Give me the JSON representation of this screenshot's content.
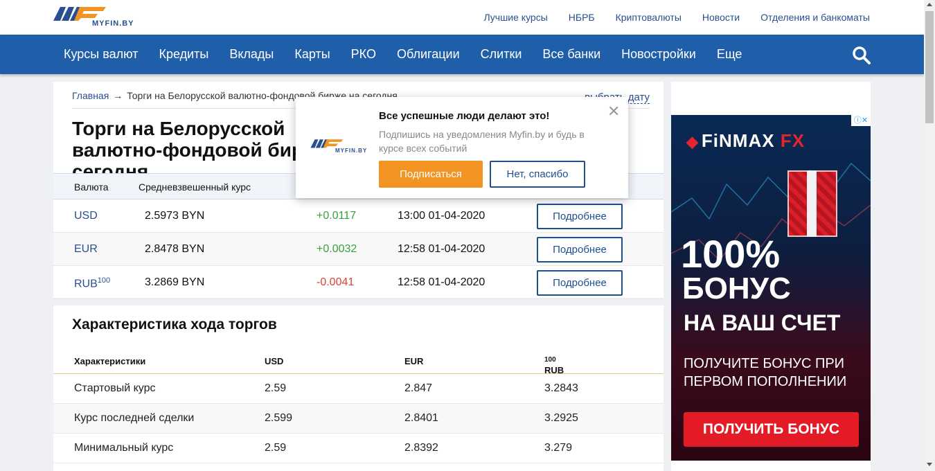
{
  "header": {
    "logo_text": "MYFIN.BY",
    "top_links": [
      "Лучшие курсы",
      "НБРБ",
      "Криптовалюты",
      "Новости",
      "Отделения и банкоматы"
    ]
  },
  "nav": {
    "items": [
      "Курсы валют",
      "Кредиты",
      "Вклады",
      "Карты",
      "РКО",
      "Облигации",
      "Слитки",
      "Все банки",
      "Новостройки",
      "Еще"
    ],
    "search_icon": "search-icon"
  },
  "breadcrumb": {
    "home": "Главная",
    "arrow": "→",
    "current": "Торги на Белорусской валютно-фондовой бирже на сегодня"
  },
  "choose_date": "выбрать дату",
  "page_title": "Торги на Белорусской валютно-фондовой бирже на сегодня",
  "rates_table": {
    "headers": [
      "Валюта",
      "Средневзвешенный курс"
    ],
    "rows": [
      {
        "currency": "USD",
        "sup": "",
        "rate": "2.5973 BYN",
        "change": "+0.0117",
        "direction": "up",
        "time": "13:00 01-04-2020",
        "button": "Подробнее"
      },
      {
        "currency": "EUR",
        "sup": "",
        "rate": "2.8478 BYN",
        "change": "+0.0032",
        "direction": "up",
        "time": "12:58 01-04-2020",
        "button": "Подробнее"
      },
      {
        "currency": "RUB",
        "sup": "100",
        "rate": "3.2869 BYN",
        "change": "-0.0041",
        "direction": "down",
        "time": "12:58 01-04-2020",
        "button": "Подробнее"
      }
    ]
  },
  "trading": {
    "title": "Характеристика хода торгов",
    "headers": [
      "Характеристики",
      "USD",
      "EUR",
      "RUB"
    ],
    "rub_sup": "100",
    "rows": [
      [
        "Стартовый курс",
        "2.59",
        "2.847",
        "3.2843"
      ],
      [
        "Курс последней сделки",
        "2.599",
        "2.8401",
        "3.2925"
      ],
      [
        "Минимальный курс",
        "2.59",
        "2.8392",
        "3.279"
      ]
    ]
  },
  "popup": {
    "title": "Все успешные люди делают это!",
    "text": "Подпишись на уведомления Myfin.by и будь в курсе всех событий",
    "subscribe": "Подписаться",
    "decline": "Нет, спасибо",
    "close": "✕",
    "logo_text": "MYFIN.BY"
  },
  "ad": {
    "brand": "FiNMAX",
    "brand_fx": "FX",
    "big1": "100%",
    "big2": "БОНУС",
    "big3": "НА ВАШ СЧЕТ",
    "small": "ПОЛУЧИТЕ БОНУС ПРИ ПЕРВОМ ПОПОЛНЕНИИ",
    "cta": "ПОЛУЧИТЬ БОНУС",
    "info": "ⓘ✕"
  },
  "colors": {
    "brand_blue": "#1f5ea8",
    "link_blue": "#2a4f8f",
    "orange": "#f39323",
    "up_green": "#36a13d",
    "down_red": "#d9413c"
  }
}
